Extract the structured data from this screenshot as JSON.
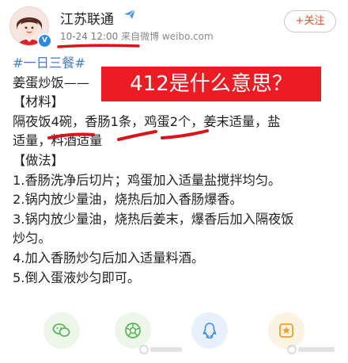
{
  "header": {
    "account_name": "江苏联通",
    "time": "10-24 12:00",
    "source": "来自微博 weibo.com",
    "follow_label": "+关注"
  },
  "post": {
    "hashtag": "#一日三餐#",
    "title": "姜蛋炒饭——",
    "section_materials": "【材料】",
    "materials": {
      "m1": "隔夜饭",
      "m1_qty": "4碗",
      "sep1": "，",
      "m2": "香肠",
      "m2_qty": "1条",
      "sep2": "，",
      "m3": "鸡蛋",
      "m3_qty": "2个",
      "rest": "，姜末适量，盐",
      "line2": "适量，料酒适量"
    },
    "section_steps": "【做法】",
    "steps": [
      "1.香肠洗净后切片；鸡蛋加入适量盐搅拌均匀。",
      "2.锅内放少量油，烧热后加入香肠爆香。",
      "3.锅内放少量油，烧热后姜末，爆香后加入隔夜饭",
      "炒匀。",
      "4.加入香肠炒匀后加入适量料酒。",
      "5.倒入蛋液炒匀即可。"
    ]
  },
  "overlay": {
    "question": "412是什么意思？",
    "question_color": "#ec1c24",
    "mark_color": "#d8141e"
  },
  "actions": [
    {
      "name": "wechat-share-icon"
    },
    {
      "name": "moments-share-icon"
    },
    {
      "name": "qq-share-icon"
    },
    {
      "name": "qzone-share-icon"
    }
  ]
}
